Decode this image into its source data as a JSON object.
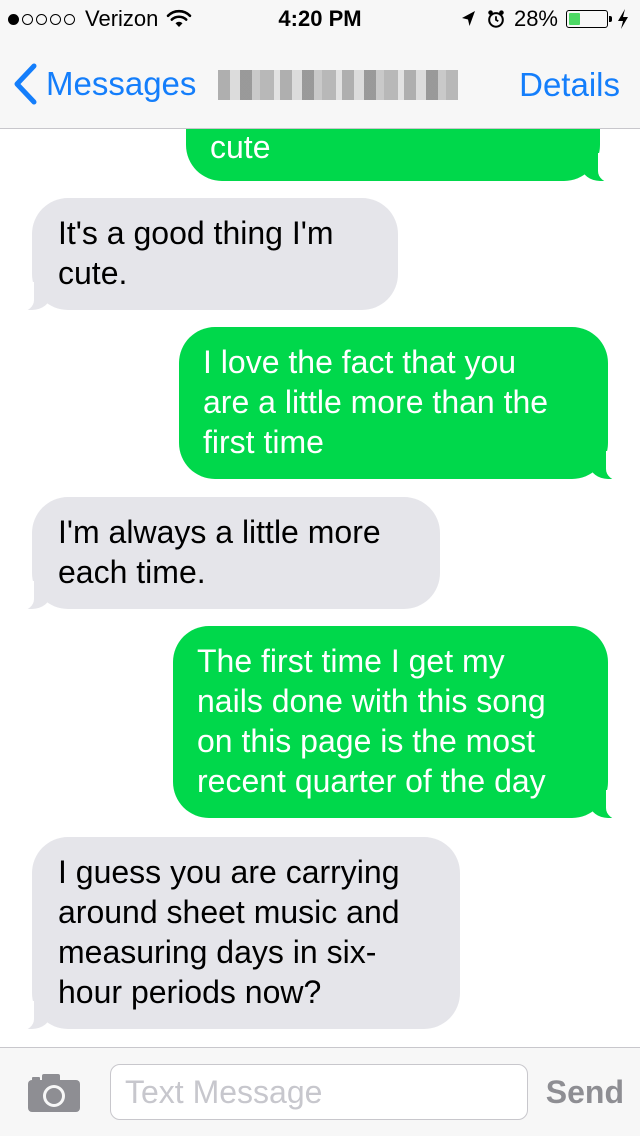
{
  "status_bar": {
    "carrier": "Verizon",
    "signal_bars_filled": 1,
    "signal_bars_total": 5,
    "time": "4:20 PM",
    "battery_percent_label": "28%",
    "battery_level": 0.28,
    "icons": [
      "wifi-icon",
      "location-arrow-icon",
      "alarm-clock-icon",
      "battery-icon",
      "charging-bolt-icon"
    ]
  },
  "nav": {
    "back_label": "Messages",
    "details_label": "Details"
  },
  "colors": {
    "sent_bubble": "#00d84b",
    "received_bubble": "#e5e5ea",
    "accent": "#147efb"
  },
  "messages": [
    {
      "direction": "sent",
      "text": "cute"
    },
    {
      "direction": "received",
      "text": "It's a good thing I'm\ncute."
    },
    {
      "direction": "sent",
      "text": "I love the fact that you\nare a little more than the\nfirst time"
    },
    {
      "direction": "received",
      "text": "I'm always a little more\neach time."
    },
    {
      "direction": "sent",
      "text": "The first time I get my\nnails done with this song\non this page is the most\nrecent quarter of the day"
    },
    {
      "direction": "received",
      "text": "I guess you are carrying\naround sheet music and\nmeasuring days in six-\nhour periods now?"
    }
  ],
  "composer": {
    "placeholder": "Text Message",
    "value": "",
    "send_label": "Send",
    "camera_icon": "camera-icon"
  }
}
